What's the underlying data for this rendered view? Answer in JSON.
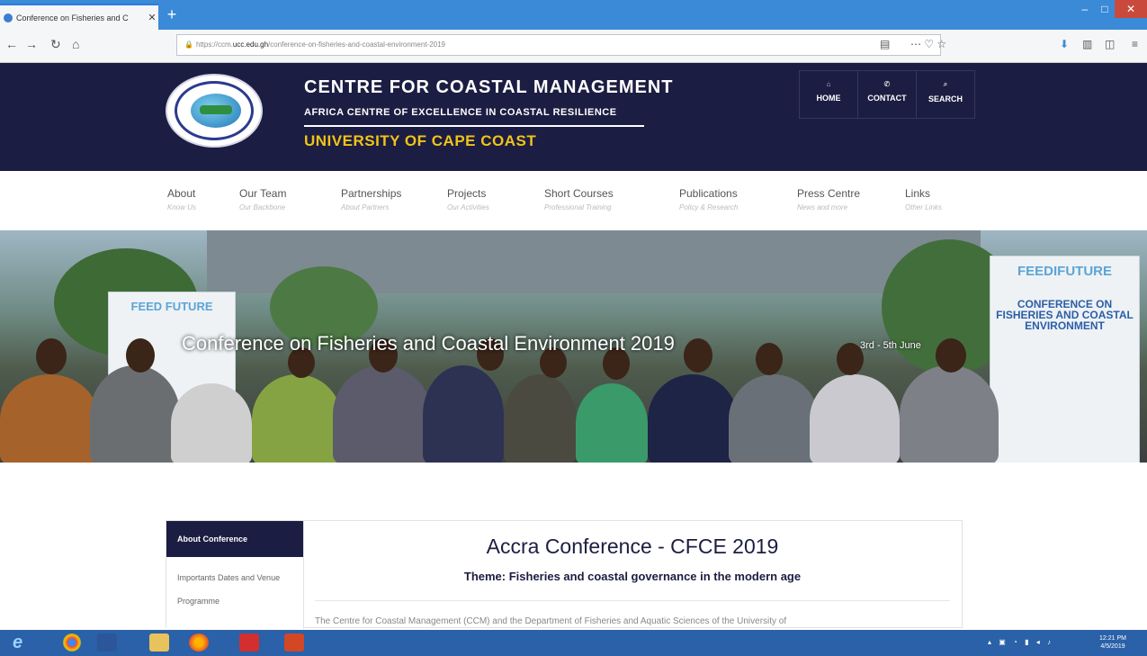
{
  "browser": {
    "tab_title": "Conference on Fisheries and C",
    "tab_close": "✕",
    "new_tab": "+",
    "url_prefix": "https://ccm.",
    "url_domain": "ucc.edu.gh",
    "url_path": "/conference-on-fisheries-and-coastal-environment-2019",
    "window_controls": [
      "–",
      "□",
      "✕"
    ]
  },
  "header": {
    "title": "CENTRE FOR COASTAL MANAGEMENT",
    "subtitle": "AFRICA CENTRE OF EXCELLENCE IN COASTAL RESILIENCE",
    "university": "UNIVERSITY OF CAPE COAST",
    "top_nav": [
      {
        "label": "HOME",
        "icon": "home-icon"
      },
      {
        "label": "CONTACT",
        "icon": "phone-icon"
      },
      {
        "label": "SEARCH",
        "icon": "search-icon"
      }
    ]
  },
  "main_nav": [
    {
      "label": "About",
      "sub": "Know Us"
    },
    {
      "label": "Our Team",
      "sub": "Our Backbone"
    },
    {
      "label": "Partnerships",
      "sub": "About Partners"
    },
    {
      "label": "Projects",
      "sub": "Our Activities"
    },
    {
      "label": "Short Courses",
      "sub": "Professional Training"
    },
    {
      "label": "Publications",
      "sub": "Policy & Research"
    },
    {
      "label": "Press Centre",
      "sub": "News and more"
    },
    {
      "label": "Links",
      "sub": "Other Links"
    }
  ],
  "hero": {
    "title": "Conference on Fisheries and Coastal Environment 2019",
    "date": "3rd - 5th June",
    "banner_left": "FEED FUTURE",
    "banner_right_brand": "FEEDIFUTURE",
    "banner_right_text": "CONFERENCE ON FISHERIES AND COASTAL ENVIRONMENT"
  },
  "sidebar": {
    "active": "About Conference",
    "items": [
      "Importants Dates and Venue",
      "Programme"
    ]
  },
  "content": {
    "title": "Accra Conference - CFCE 2019",
    "theme": "Theme: Fisheries and coastal governance in the modern age",
    "body": "The Centre for Coastal Management (CCM) and the Department of Fisheries and Aquatic Sciences of the University of"
  },
  "taskbar": {
    "time": "12:21 PM",
    "date": "4/5/2019"
  }
}
